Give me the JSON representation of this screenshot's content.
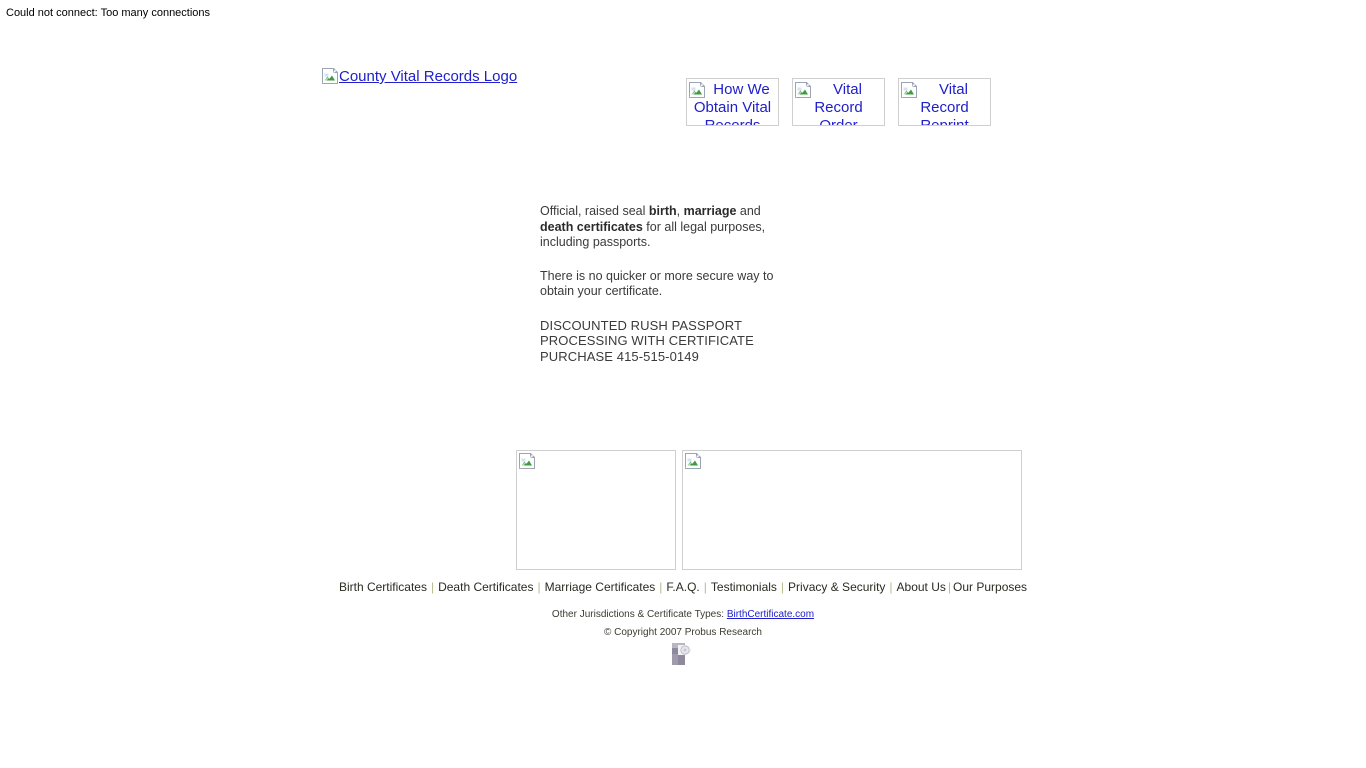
{
  "error_banner": {
    "text": "Could not connect: Too many connections"
  },
  "header": {
    "logo": {
      "alt_text": "County Vital Records Logo",
      "icon": "broken-image-icon"
    },
    "nav_buttons": [
      {
        "alt_text": "How We Obtain Vital Records",
        "icon": "broken-image-icon"
      },
      {
        "alt_text": "Vital Record Order",
        "icon": "broken-image-icon"
      },
      {
        "alt_text": "Vital Record Reprint",
        "icon": "broken-image-icon"
      }
    ]
  },
  "main": {
    "paragraph1": {
      "part1": "Official, raised seal ",
      "bold1": "birth",
      "part2": ", ",
      "bold2": "marriage",
      "part3": " and ",
      "bold3": "death certificates",
      "part4": " for all legal purposes, including passports."
    },
    "paragraph2": "There is no quicker or more secure way to obtain your certificate.",
    "rush_promo": {
      "line1": "DISCOUNTED RUSH PASSPORT",
      "line2": "PROCESSING WITH CERTIFICATE",
      "line3": "PURCHASE 415-515-0149",
      "phone": "415-515-0149"
    }
  },
  "media_boxes": [
    {
      "name": "left-image-placeholder",
      "icon": "broken-image-icon"
    },
    {
      "name": "right-image-placeholder",
      "icon": "broken-image-icon"
    }
  ],
  "footer": {
    "links": [
      "Birth Certificates",
      "Death Certificates",
      "Marriage Certificates",
      "F.A.Q.",
      "Testimonials",
      "Privacy & Security",
      "About Us",
      "Our Purposes"
    ],
    "separator": "|",
    "other_jurisdictions_label": "Other Jurisdictions & Certificate Types:",
    "other_jurisdictions_link": "BirthCertificate.com",
    "copyright": "© Copyright 2007 Probus Research",
    "tracker_icon": "tracker-image"
  },
  "colors": {
    "link_blue": "#2020cc",
    "body_text": "#3a3a3a",
    "separator": "#b9b98a",
    "border": "#cfcfcf"
  }
}
